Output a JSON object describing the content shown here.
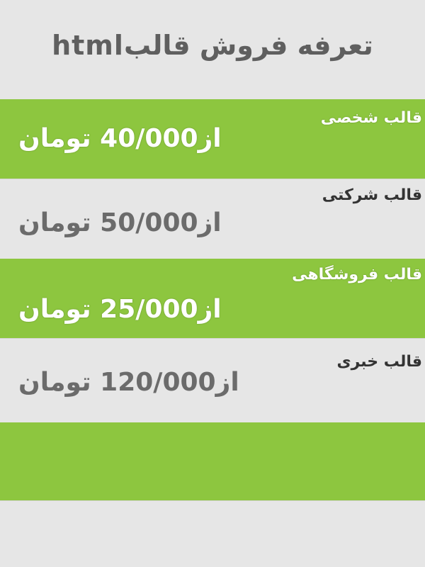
{
  "header": {
    "title": "تعرفه فروش قالبhtml"
  },
  "plans": [
    {
      "name": "قالب  شخصی",
      "price": "از40/000 تومان"
    },
    {
      "name": "قالب  شرکتی",
      "price": "از50/000 تومان"
    },
    {
      "name": "قالب  فروشگاهی",
      "price": "از25/000 تومان"
    },
    {
      "name": "قالب  خبری",
      "price": "از120/000 تومان"
    }
  ],
  "colors": {
    "green": "#8dc63f",
    "gray": "#e6e6e6",
    "title_text": "#5f5f5f",
    "price_gray_text": "#6b6b6b"
  }
}
